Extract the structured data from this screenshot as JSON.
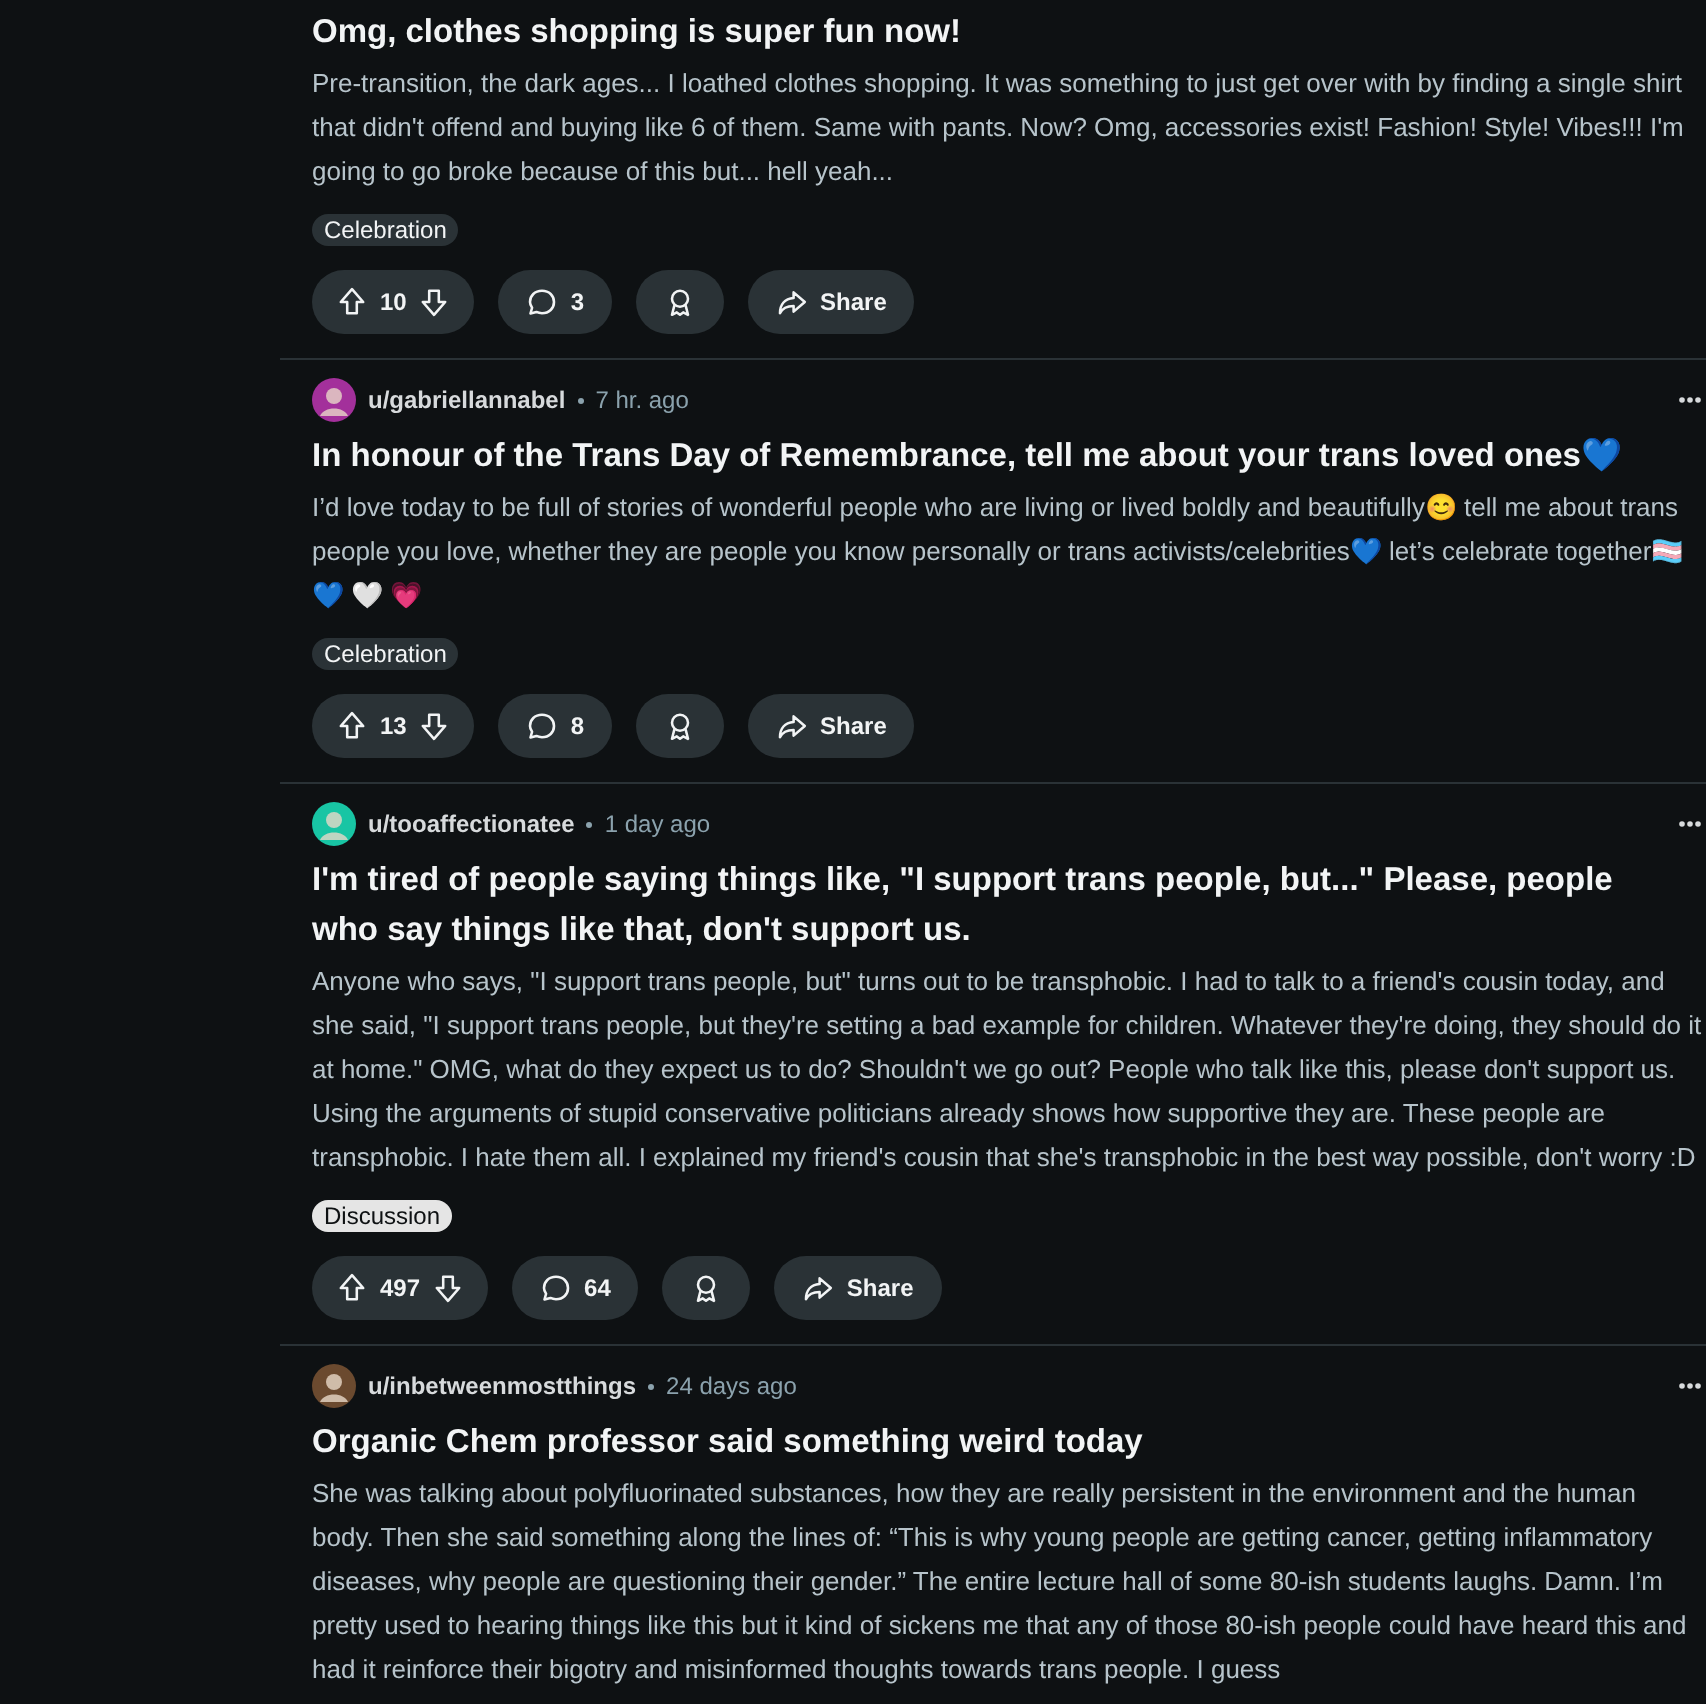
{
  "posts": [
    {
      "title": "Omg, clothes shopping is super fun now!",
      "body": "Pre-transition, the dark ages... I loathed clothes shopping. It was something to just get over with by finding a single shirt that didn't offend and buying like 6 of them. Same with pants. Now? Omg, accessories exist! Fashion! Style! Vibes!!! I'm going to go broke because of this but... hell yeah...",
      "flair": {
        "label": "Celebration",
        "color": "#2a3236"
      },
      "votes": "10",
      "comments": "3",
      "share": "Share"
    },
    {
      "user": "u/gabriellannabel",
      "time": "7 hr. ago",
      "title": "In honour of the Trans Day of Remembrance, tell me about your trans loved ones💙",
      "body": "I’d love today to be full of stories of wonderful people who are living or lived boldly and beautifully😊  tell me about trans people you love, whether they are people you know personally or trans activists/celebrities💙 let’s celebrate together🏳️‍⚧️ 💙 🤍 💗",
      "flair": {
        "label": "Celebration",
        "color": "#2a3236"
      },
      "votes": "13",
      "comments": "8",
      "share": "Share"
    },
    {
      "user": "u/tooaffectionatee",
      "time": "1 day ago",
      "title": "I'm tired of people saying things like, \"I support trans people, but...\" Please, people who say things like that, don't support us.",
      "body": "Anyone who says, \"I support trans people, but\" turns out to be transphobic. I had to talk to a friend's cousin today, and she said, \"I support trans people, but they're setting a bad example for children. Whatever they're doing, they should do it at home.\" OMG, what do they expect us to do? Shouldn't we go out? People who talk like this, please don't support us. Using the arguments of stupid conservative politicians already shows how supportive they are. These people are transphobic. I hate them all. I explained my friend's cousin that she's transphobic in the best way possible, don't worry :D",
      "flair": {
        "label": "Discussion",
        "color": "#e5e5e5"
      },
      "votes": "497",
      "comments": "64",
      "share": "Share"
    },
    {
      "user": "u/inbetweenmostthings",
      "time": "24 days ago",
      "title": "Organic Chem professor said something weird today",
      "body": "She was talking about polyfluorinated substances, how they are really persistent in the environment and the human body. Then she said something along the lines of: “This is why young people are getting cancer, getting inflammatory diseases, why people are questioning their gender.” The entire lecture hall of some 80-ish students laughs. Damn. I’m pretty used to hearing things like this but it kind of sickens me that any of those 80-ish people could have heard this and had it reinforce their bigotry and misinformed thoughts towards trans people. I guess"
    }
  ]
}
